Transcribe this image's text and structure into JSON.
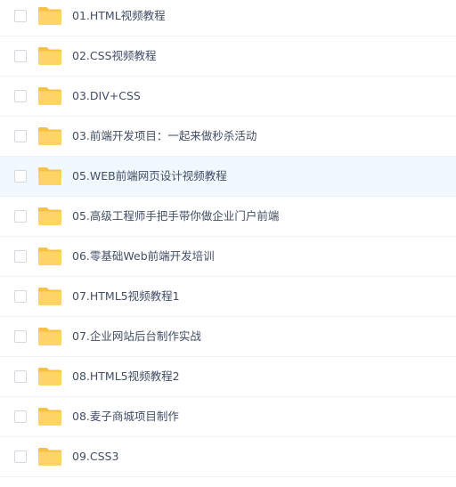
{
  "file_list": {
    "hover_index": 4,
    "folder_icon": "folder-icon",
    "colors": {
      "folder_body": "#ffd466",
      "folder_tab": "#f7c243",
      "text": "#424e67",
      "row_hover_bg": "#f1f8ff",
      "divider": "#f0f2f5",
      "checkbox_border": "#d4d8df"
    },
    "items": [
      {
        "label": "01.HTML视频教程"
      },
      {
        "label": "02.CSS视频教程"
      },
      {
        "label": "03.DIV+CSS"
      },
      {
        "label": "03.前端开发项目：一起来做秒杀活动"
      },
      {
        "label": "05.WEB前端网页设计视频教程"
      },
      {
        "label": "05.高级工程师手把手带你做企业门户前端"
      },
      {
        "label": "06.零基础Web前端开发培训"
      },
      {
        "label": "07.HTML5视频教程1"
      },
      {
        "label": "07.企业网站后台制作实战"
      },
      {
        "label": "08.HTML5视频教程2"
      },
      {
        "label": "08.麦子商城项目制作"
      },
      {
        "label": "09.CSS3"
      }
    ]
  }
}
